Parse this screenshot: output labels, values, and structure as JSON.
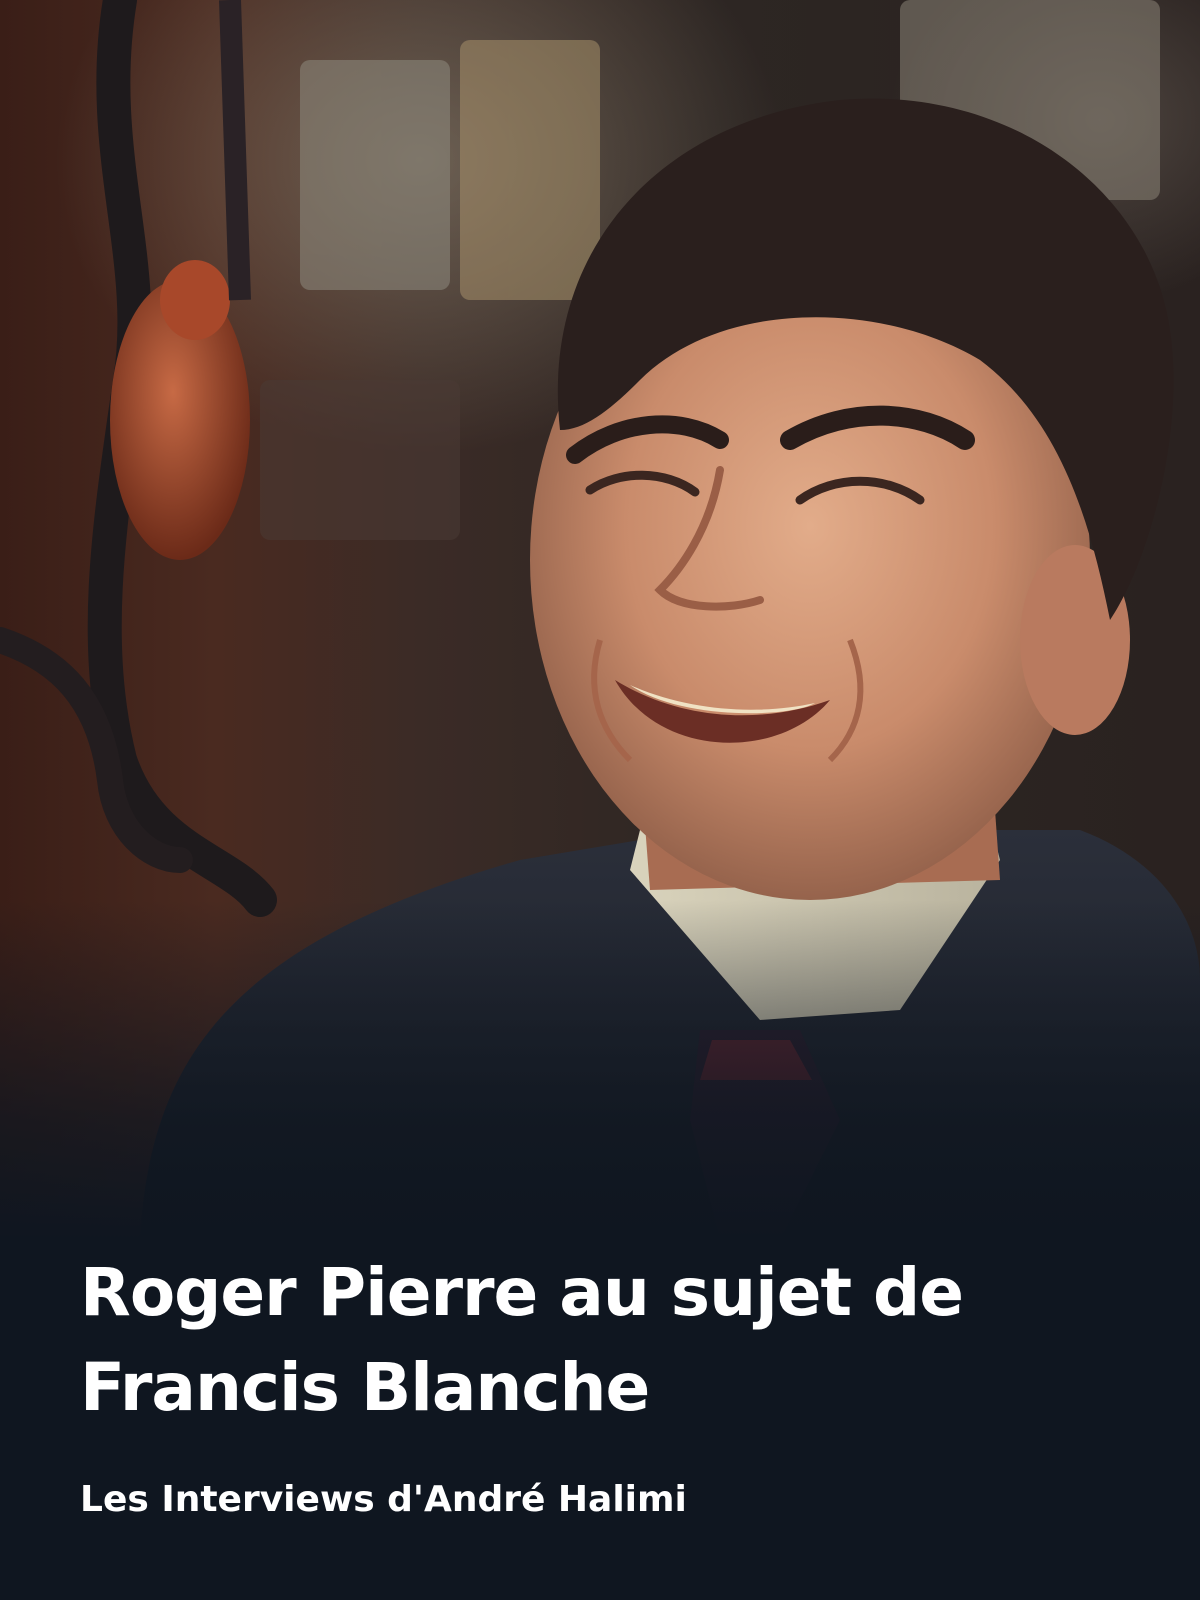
{
  "program": {
    "title": "Roger Pierre au sujet de Francis Blanche",
    "subtitle": "Les Interviews d'André Halimi"
  },
  "colors": {
    "background": "#0f1620",
    "text": "#ffffff"
  }
}
